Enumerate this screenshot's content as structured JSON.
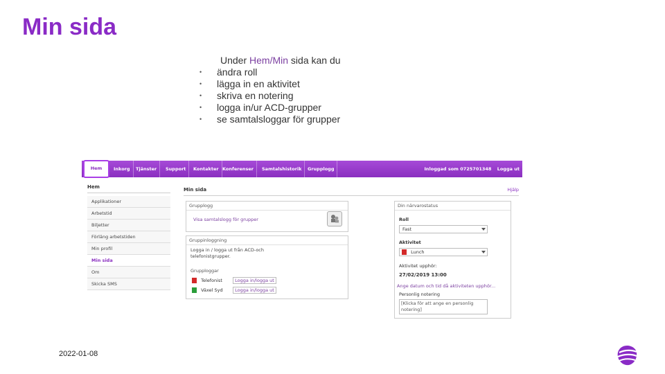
{
  "slide": {
    "title": "Min sida",
    "intro_prefix": "Under ",
    "intro_accent": "Hem/Min",
    "intro_suffix": " sida kan du",
    "bullets": [
      "ändra roll",
      "lägga in en aktivitet",
      "skriva en notering",
      "logga in/ur ACD-grupper",
      "se samtalsloggar för grupper"
    ],
    "date": "2022-01-08"
  },
  "app": {
    "nav": [
      "Hem",
      "Inkorg",
      "Tjänster",
      "Support",
      "Kontakter",
      "Konferenser",
      "Samtalshistorik",
      "Grupplogg"
    ],
    "user_label": "Inloggad som 0725701348",
    "logout": "Logga ut",
    "left_head": "Hem",
    "left_items": [
      "Applikationer",
      "Arbetstid",
      "Biljetter",
      "Förläng arbetstiden",
      "Min profil",
      "Min sida",
      "Om",
      "Skicka SMS"
    ],
    "main_head": "Min sida",
    "help": "Hjälp",
    "group_log_title": "Grupplogg",
    "group_log_link": "Visa samtalslogg för grupper",
    "group_login_title": "Gruppinloggning",
    "group_login_text": "Logga in / logga ut från ACD-och telefonistgrupper.",
    "groups_title": "Grupploggar",
    "groups": [
      {
        "name": "Telefonist",
        "action": "Logga in/logga ut",
        "status": "red"
      },
      {
        "name": "Växel Syd",
        "action": "Logga in/logga ut",
        "status": "green"
      }
    ],
    "presence_title": "Din närvarostatus",
    "role_label": "Roll",
    "role_value": "Fast",
    "activity_label": "Aktivitet",
    "activity_value": "Lunch",
    "ends_label": "Aktivitet upphör:",
    "ends_value": "27/02/2019 13:00",
    "date_link": "Ange datum och tid då aktiviteten upphör...",
    "note_label": "Personlig notering",
    "note_placeholder": "[Klicka för att ange en personlig notering]"
  }
}
